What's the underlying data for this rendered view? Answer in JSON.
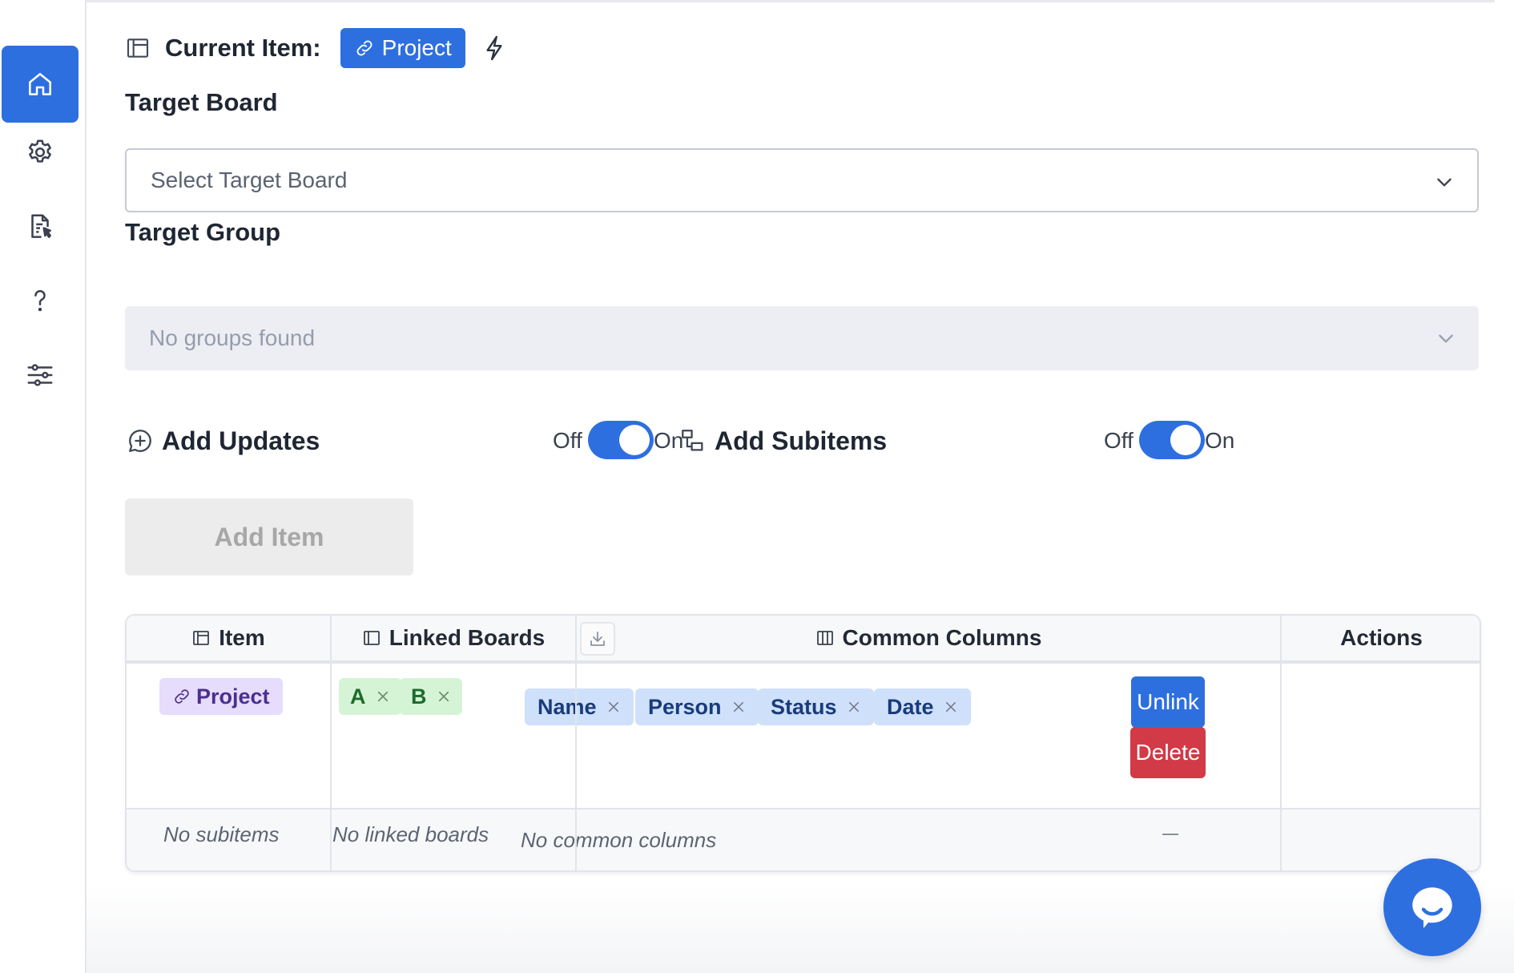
{
  "sidebar": {
    "items": [
      {
        "icon": "home-icon",
        "active": true
      },
      {
        "icon": "gear-icon",
        "active": false
      },
      {
        "icon": "document-cursor-icon",
        "active": false
      },
      {
        "icon": "question-icon",
        "active": false
      },
      {
        "icon": "sliders-icon",
        "active": false
      }
    ]
  },
  "current_item": {
    "label": "Current Item:",
    "pill": "Project",
    "pill_icon": "link-icon",
    "action_icon": "bolt-icon"
  },
  "target_board": {
    "label": "Target Board",
    "placeholder": "Select Target Board"
  },
  "target_group": {
    "label": "Target Group",
    "placeholder": "No groups found"
  },
  "add_updates": {
    "title": "Add Updates",
    "off_label": "Off",
    "on_label": "On",
    "enabled": true
  },
  "add_subitems": {
    "title": "Add Subitems",
    "off_label": "Off",
    "on_label": "On",
    "enabled": true
  },
  "add_item_button": "Add Item",
  "table": {
    "headers": {
      "item": "Item",
      "linked_boards": "Linked Boards",
      "common_columns": "Common Columns",
      "actions": "Actions"
    },
    "row": {
      "item": "Project",
      "linked_boards": [
        "A",
        "B"
      ],
      "common_columns": [
        "Name",
        "Person",
        "Status",
        "Date"
      ],
      "unlink_label": "Unlink",
      "delete_label": "Delete"
    },
    "subrow": {
      "item": "No subitems",
      "linked_boards": "No linked boards",
      "common_columns": "No common columns"
    }
  },
  "colors": {
    "accent": "#2e6fe0",
    "danger": "#d13a46",
    "item_tag_bg": "#e6dcfb",
    "board_tag_bg": "#d5f4d6",
    "column_tag_bg": "#cfe0fb"
  }
}
